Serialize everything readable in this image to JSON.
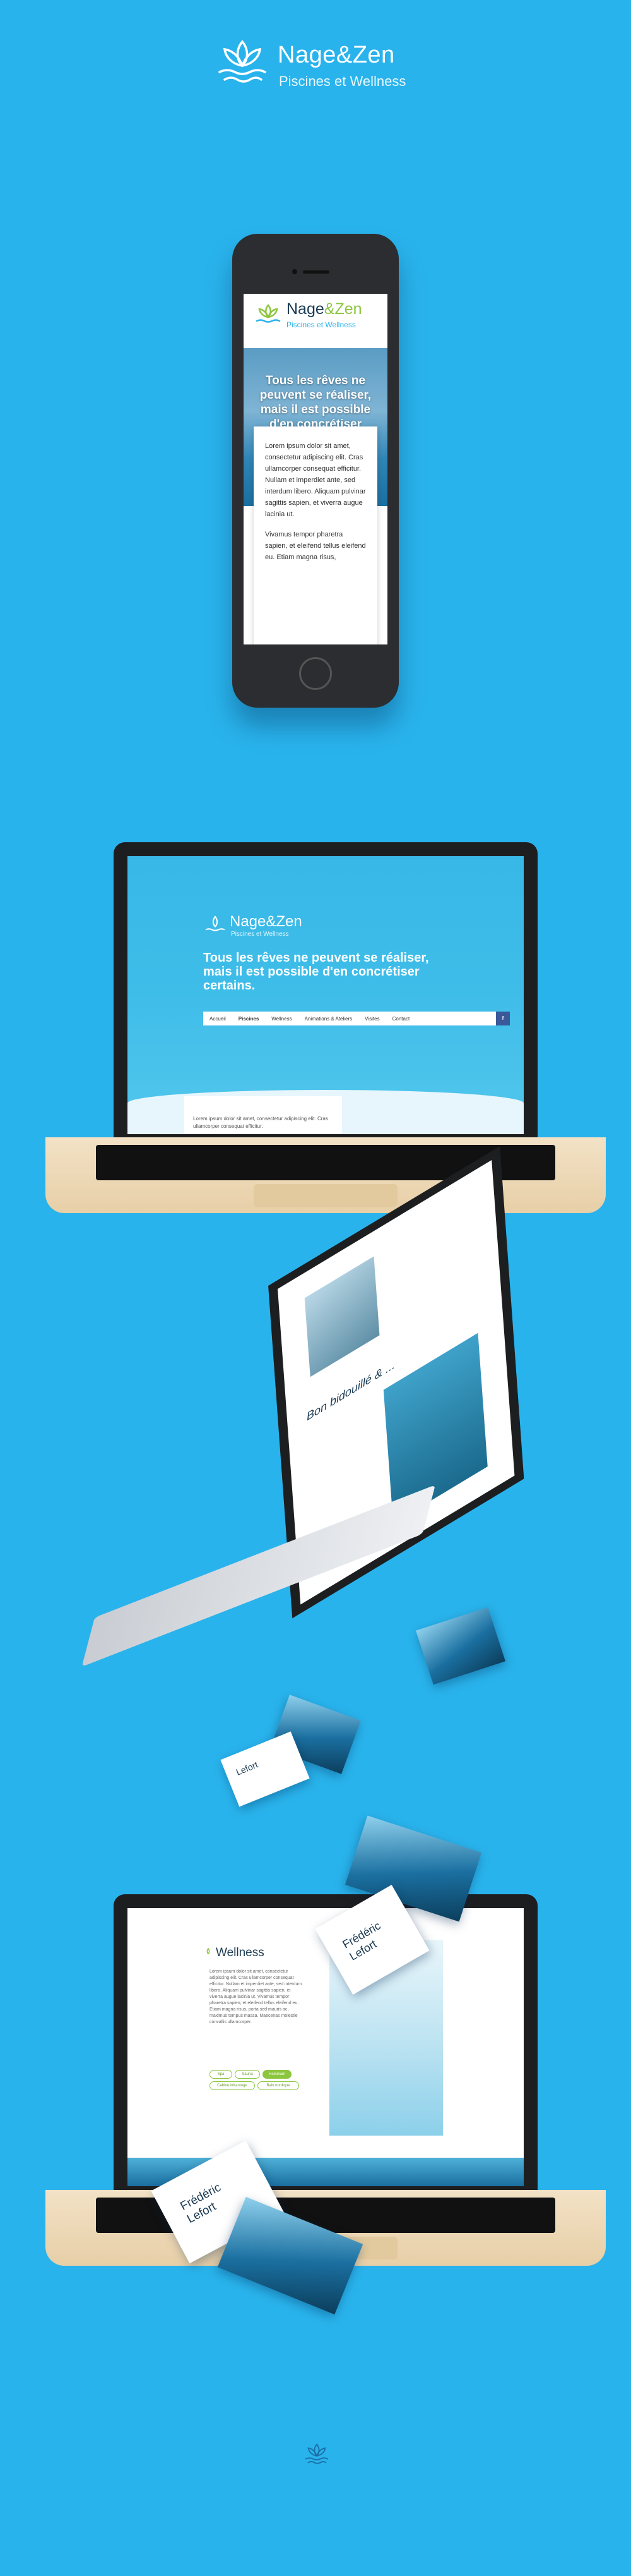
{
  "brand": {
    "name": "Nage&Zen",
    "name_part1": "Nage",
    "name_part2": "&Zen",
    "tagline": "Piscines et Wellness",
    "colors": {
      "background": "#29b3ec",
      "accent_green": "#8cc63f",
      "navy": "#1b3b53"
    }
  },
  "mobile": {
    "hero_text": "Tous les rêves ne peuvent se réaliser, mais il est possible d'en concrétiser certains.",
    "body_text_1": "Lorem ipsum dolor sit amet, consectetur adipiscing elit. Cras ullamcorper consequat efficitur. Nullam et imperdiet ante, sed interdum libero. Aliquam pulvinar sagittis sapien, et viverra augue lacinia ut.",
    "body_text_2": "Vivamus tempor pharetra sapien, et eleifend tellus eleifend eu. Etiam magna risus,"
  },
  "desktop": {
    "hero_text": "Tous les rêves ne peuvent se réaliser, mais il est possible d'en concrétiser certains.",
    "nav": [
      "Accueil",
      "Piscines",
      "Wellness",
      "Animations & Ateliers",
      "Visites",
      "Contact"
    ],
    "facebook_label": "f",
    "card_text": "Lorem ipsum dolor sit amet, consectetur adipiscing elit. Cras ullamcorper consequat efficitur."
  },
  "floating": {
    "section_title": "Bon bidouillé & ...",
    "card_name": "Frédéric Lefort",
    "card_name_short": "Lefort"
  },
  "wellness": {
    "title": "Wellness",
    "text": "Lorem ipsum dolor sit amet, consectetur adipiscing elit. Cras ullamcorper consequat efficitur. Nullam et imperdiet ante, sed interdum libero. Aliquam pulvinar sagittis sapien, et viverra augue lacinia ut. Vivamus tempor pharetra sapien, et eleifend tellus eleifend eu. Etiam magna risus, porta sed mauris ac, maximus tempus massa. Maecenas molestie convallis ullamcorper.",
    "chips": [
      "Spa",
      "Sauna",
      "Hammam",
      "Cabine infrarouge",
      "Bain nordique"
    ]
  },
  "business_card": {
    "first_name": "Frédéric",
    "last_name": "Lefort"
  }
}
